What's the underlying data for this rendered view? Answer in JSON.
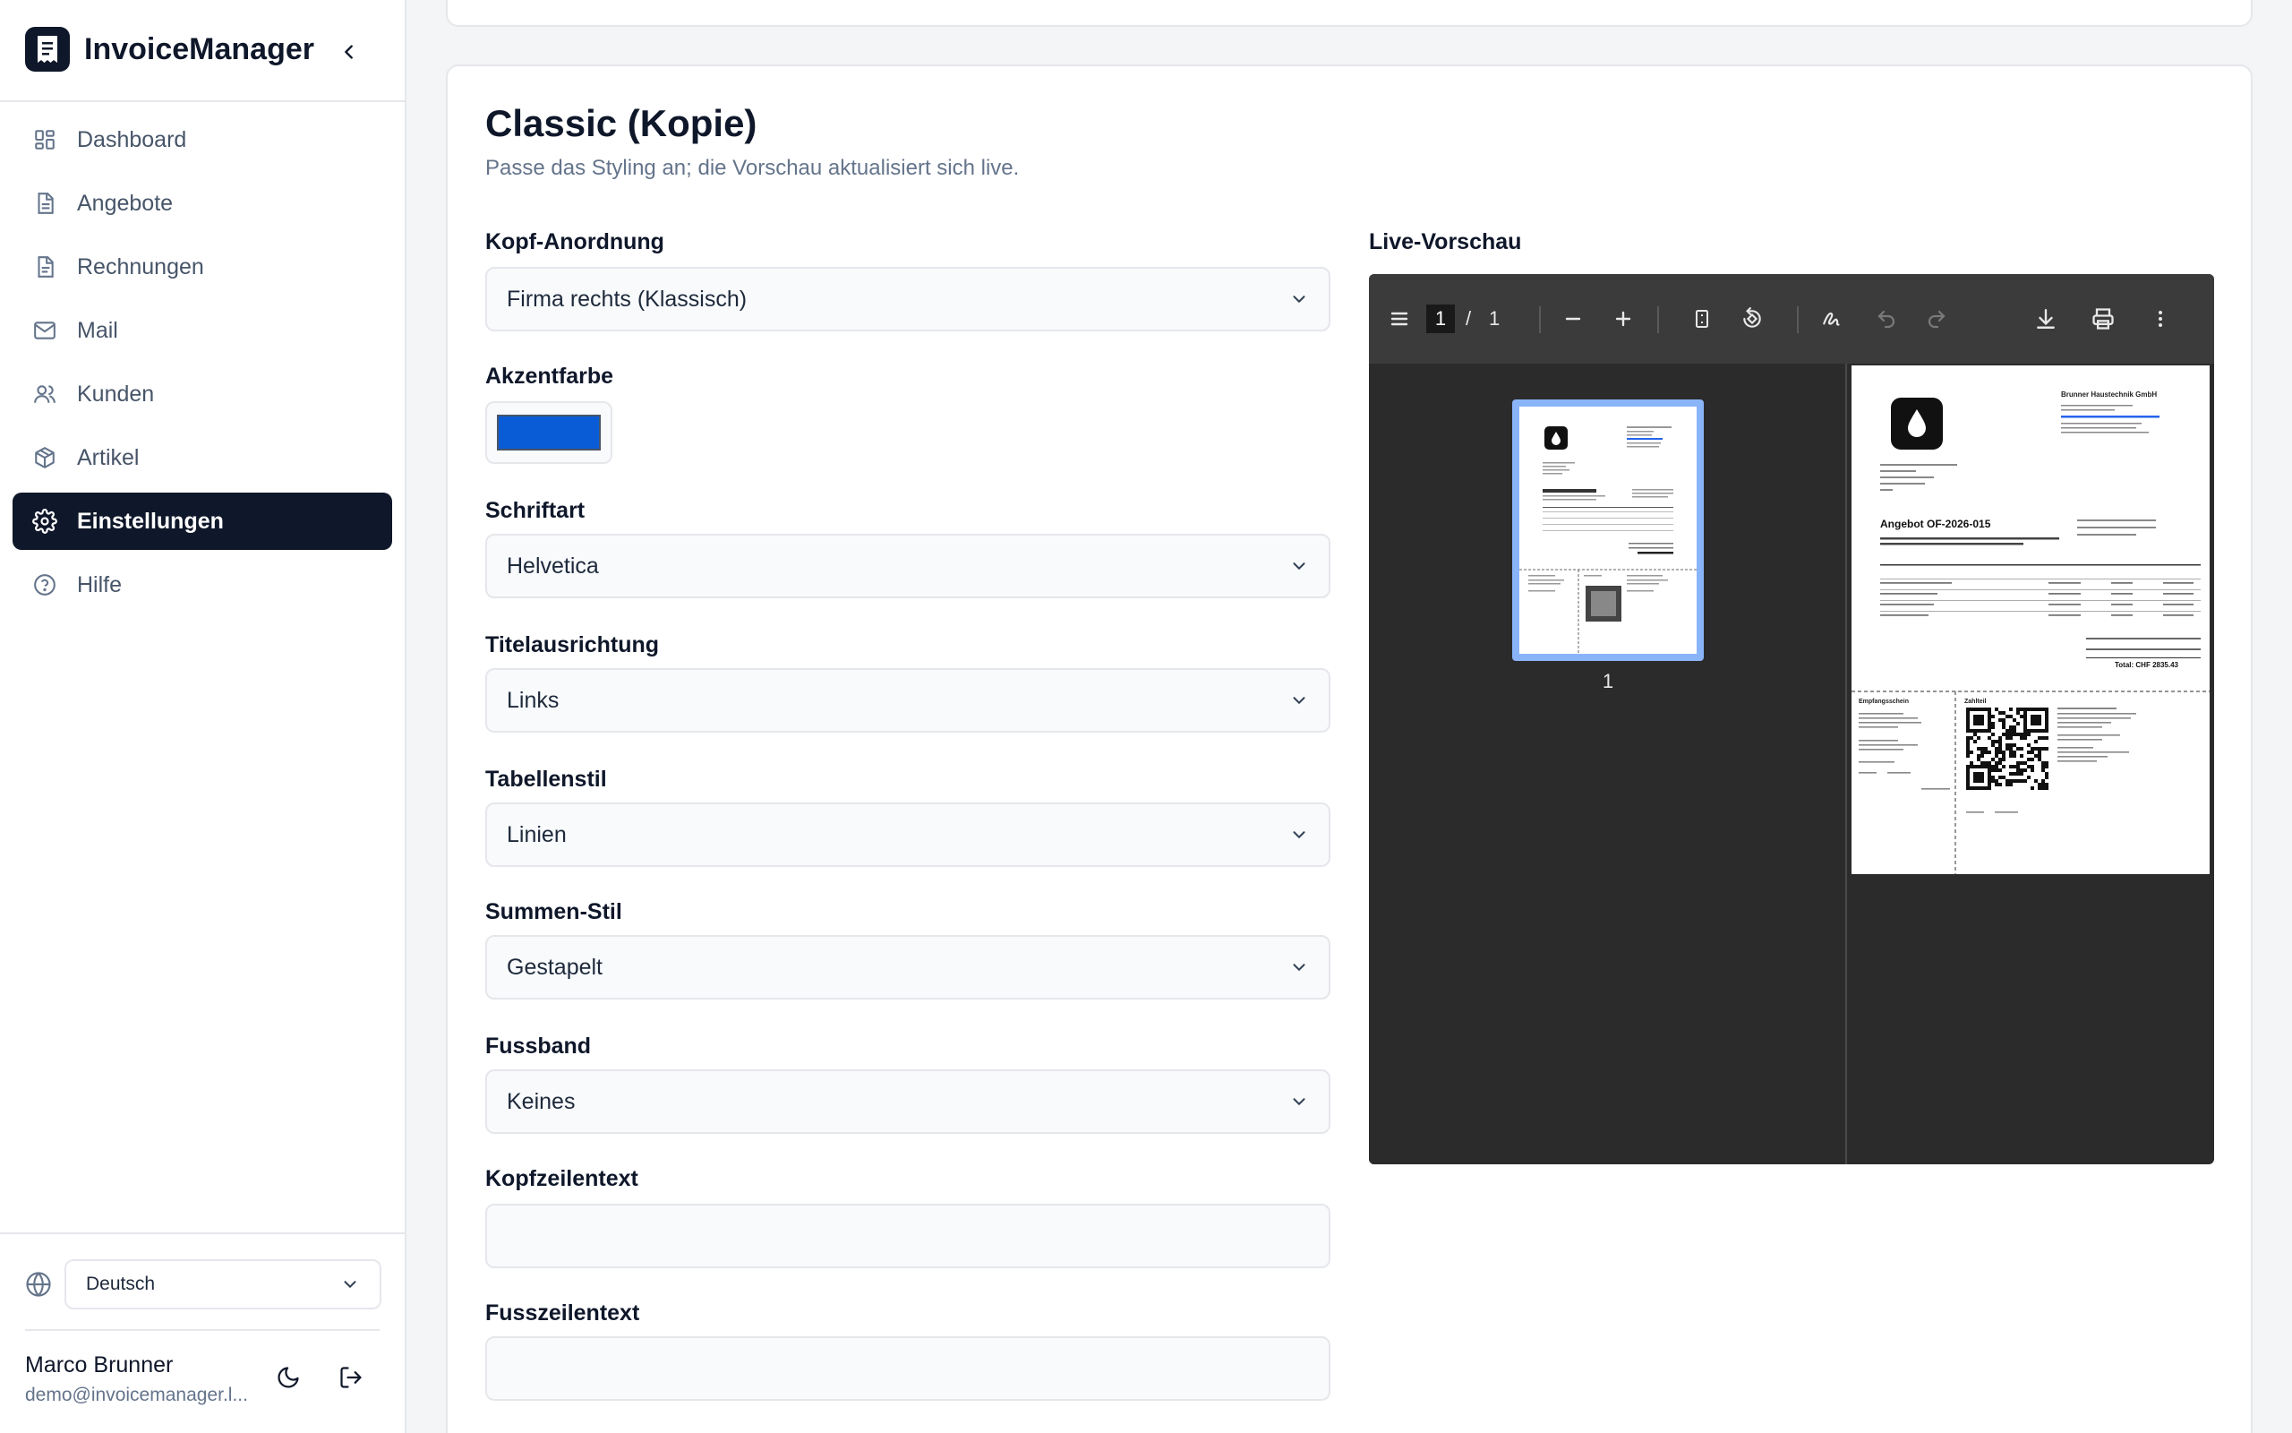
{
  "app": {
    "name": "InvoiceManager"
  },
  "sidebar": {
    "items": [
      {
        "label": "Dashboard",
        "icon": "dashboard-icon",
        "active": false
      },
      {
        "label": "Angebote",
        "icon": "document-icon",
        "active": false
      },
      {
        "label": "Rechnungen",
        "icon": "document-icon",
        "active": false
      },
      {
        "label": "Mail",
        "icon": "mail-icon",
        "active": false
      },
      {
        "label": "Kunden",
        "icon": "users-icon",
        "active": false
      },
      {
        "label": "Artikel",
        "icon": "package-icon",
        "active": false
      },
      {
        "label": "Einstellungen",
        "icon": "gear-icon",
        "active": true
      },
      {
        "label": "Hilfe",
        "icon": "help-icon",
        "active": false
      }
    ],
    "language": "Deutsch",
    "user": {
      "name": "Marco Brunner",
      "email": "demo@invoicemanager.l..."
    }
  },
  "editor": {
    "title": "Classic (Kopie)",
    "subtitle": "Passe das Styling an; die Vorschau aktualisiert sich live.",
    "fields": {
      "header_layout": {
        "label": "Kopf-Anordnung",
        "value": "Firma rechts (Klassisch)"
      },
      "accent": {
        "label": "Akzentfarbe",
        "color": "#0a5cd6"
      },
      "font": {
        "label": "Schriftart",
        "value": "Helvetica"
      },
      "title_align": {
        "label": "Titelausrichtung",
        "value": "Links"
      },
      "table_style": {
        "label": "Tabellenstil",
        "value": "Linien"
      },
      "totals_style": {
        "label": "Summen-Stil",
        "value": "Gestapelt"
      },
      "footer_band": {
        "label": "Fussband",
        "value": "Keines"
      },
      "header_text": {
        "label": "Kopfzeilentext",
        "value": ""
      },
      "footer_text": {
        "label": "Fusszeilentext",
        "value": ""
      }
    }
  },
  "preview": {
    "label": "Live-Vorschau",
    "current_page": "1",
    "page_sep": "/",
    "total_pages": "1",
    "thumb_label": "1",
    "doc": {
      "company": "Brunner Haustechnik GmbH",
      "title": "Angebot OF-2026-015",
      "total": "Total: CHF 2835.43",
      "receipt_title": "Empfangsschein",
      "payment_title": "Zahlteil"
    }
  },
  "colors": {
    "primary": "#0f172a",
    "muted": "#64748b",
    "border": "#e5e7eb"
  }
}
